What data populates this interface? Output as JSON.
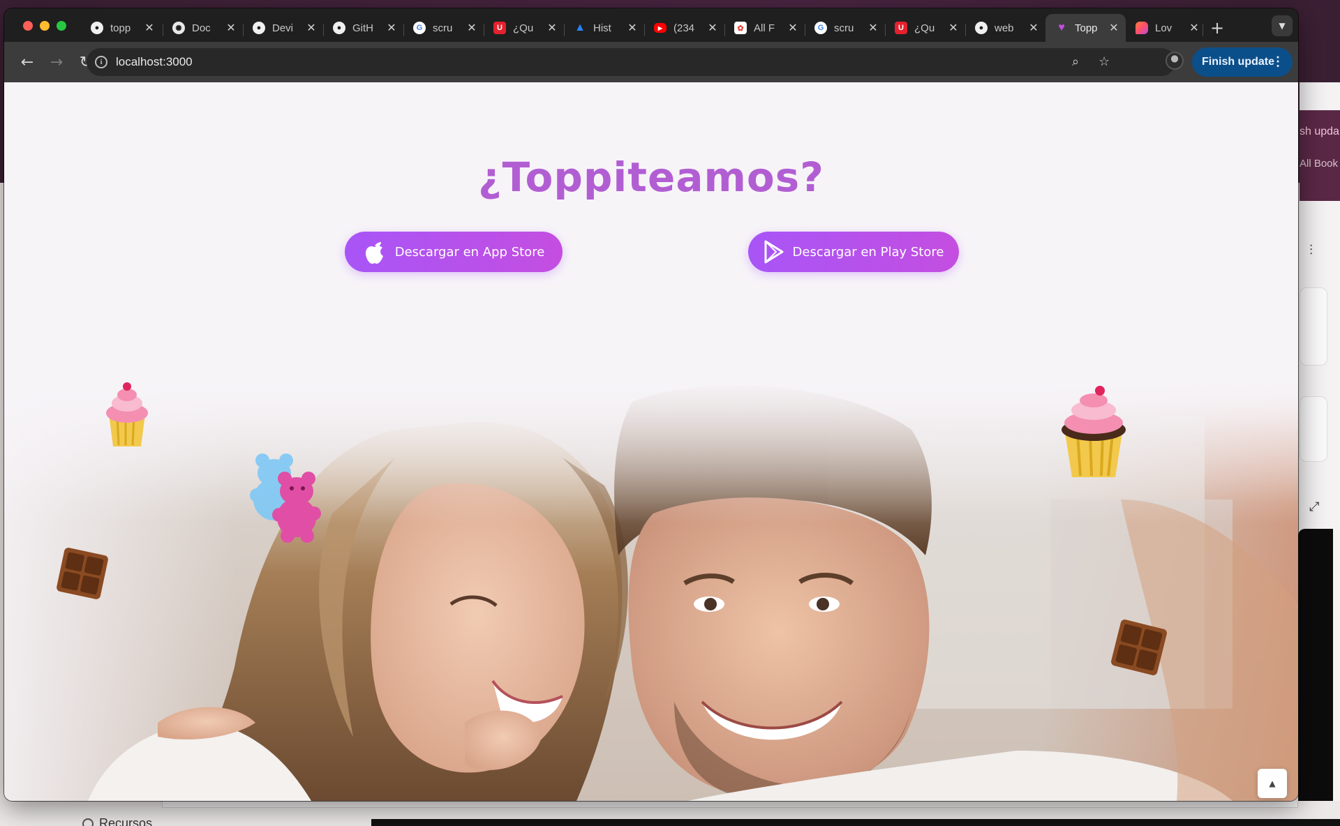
{
  "browser": {
    "tabs": [
      {
        "title": "topp",
        "icon": "github-icon",
        "color": "#1f1f1f"
      },
      {
        "title": "Doc",
        "icon": "openai-icon",
        "color": "#1f1f1f"
      },
      {
        "title": "Devi",
        "icon": "github-icon",
        "color": "#1f1f1f"
      },
      {
        "title": "GitH",
        "icon": "github-icon",
        "color": "#1f1f1f"
      },
      {
        "title": "scru",
        "icon": "google-icon",
        "color": "#ffffff"
      },
      {
        "title": "¿Qu",
        "icon": "udemy-icon",
        "color": "#e5212d"
      },
      {
        "title": "Hist",
        "icon": "jira-icon",
        "color": "#2684ff"
      },
      {
        "title": "(234",
        "icon": "youtube-icon",
        "color": "#ff0000"
      },
      {
        "title": "All F",
        "icon": "google-photos-icon",
        "color": "#e94235"
      },
      {
        "title": "scru",
        "icon": "google-icon",
        "color": "#ffffff"
      },
      {
        "title": "¿Qu",
        "icon": "udemy-icon",
        "color": "#e5212d"
      },
      {
        "title": "web",
        "icon": "github-icon",
        "color": "#1f1f1f"
      },
      {
        "title": "Topp",
        "icon": "heart-icon",
        "color": "#c44ee0",
        "active": true
      },
      {
        "title": "Lov",
        "icon": "lovable-icon",
        "color": "#ff4f6a"
      }
    ],
    "url": "localhost:3000",
    "finish_update_label": "Finish update"
  },
  "page": {
    "title": "¿Toppiteamos?",
    "app_store_label": "Descargar en App Store",
    "play_store_label": "Descargar en Play Store",
    "accent": "#b25ed3",
    "button_gradient": [
      "#a855f7",
      "#c44ee0"
    ]
  },
  "background": {
    "peek_update": "sh upda",
    "peek_books": "All Book",
    "recursos": "Recursos"
  }
}
